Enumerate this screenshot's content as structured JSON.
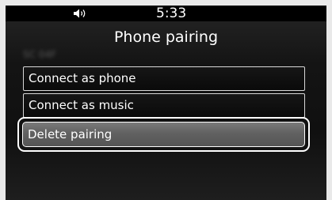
{
  "status_bar": {
    "volume_icon": "speaker-volume-icon",
    "time": "5:33"
  },
  "header": {
    "title": "Phone pairing"
  },
  "device": {
    "name": "SC 04F"
  },
  "menu": {
    "items": [
      {
        "label": "Connect as phone",
        "selected": false
      },
      {
        "label": "Connect as music",
        "selected": false
      },
      {
        "label": "Delete pairing",
        "selected": true
      }
    ]
  },
  "colors": {
    "background": "#101010",
    "status_bar": "#000000",
    "text": "#ffffff",
    "item_border": "#d8d8d8",
    "selected_fill": "#6a6a6a"
  }
}
